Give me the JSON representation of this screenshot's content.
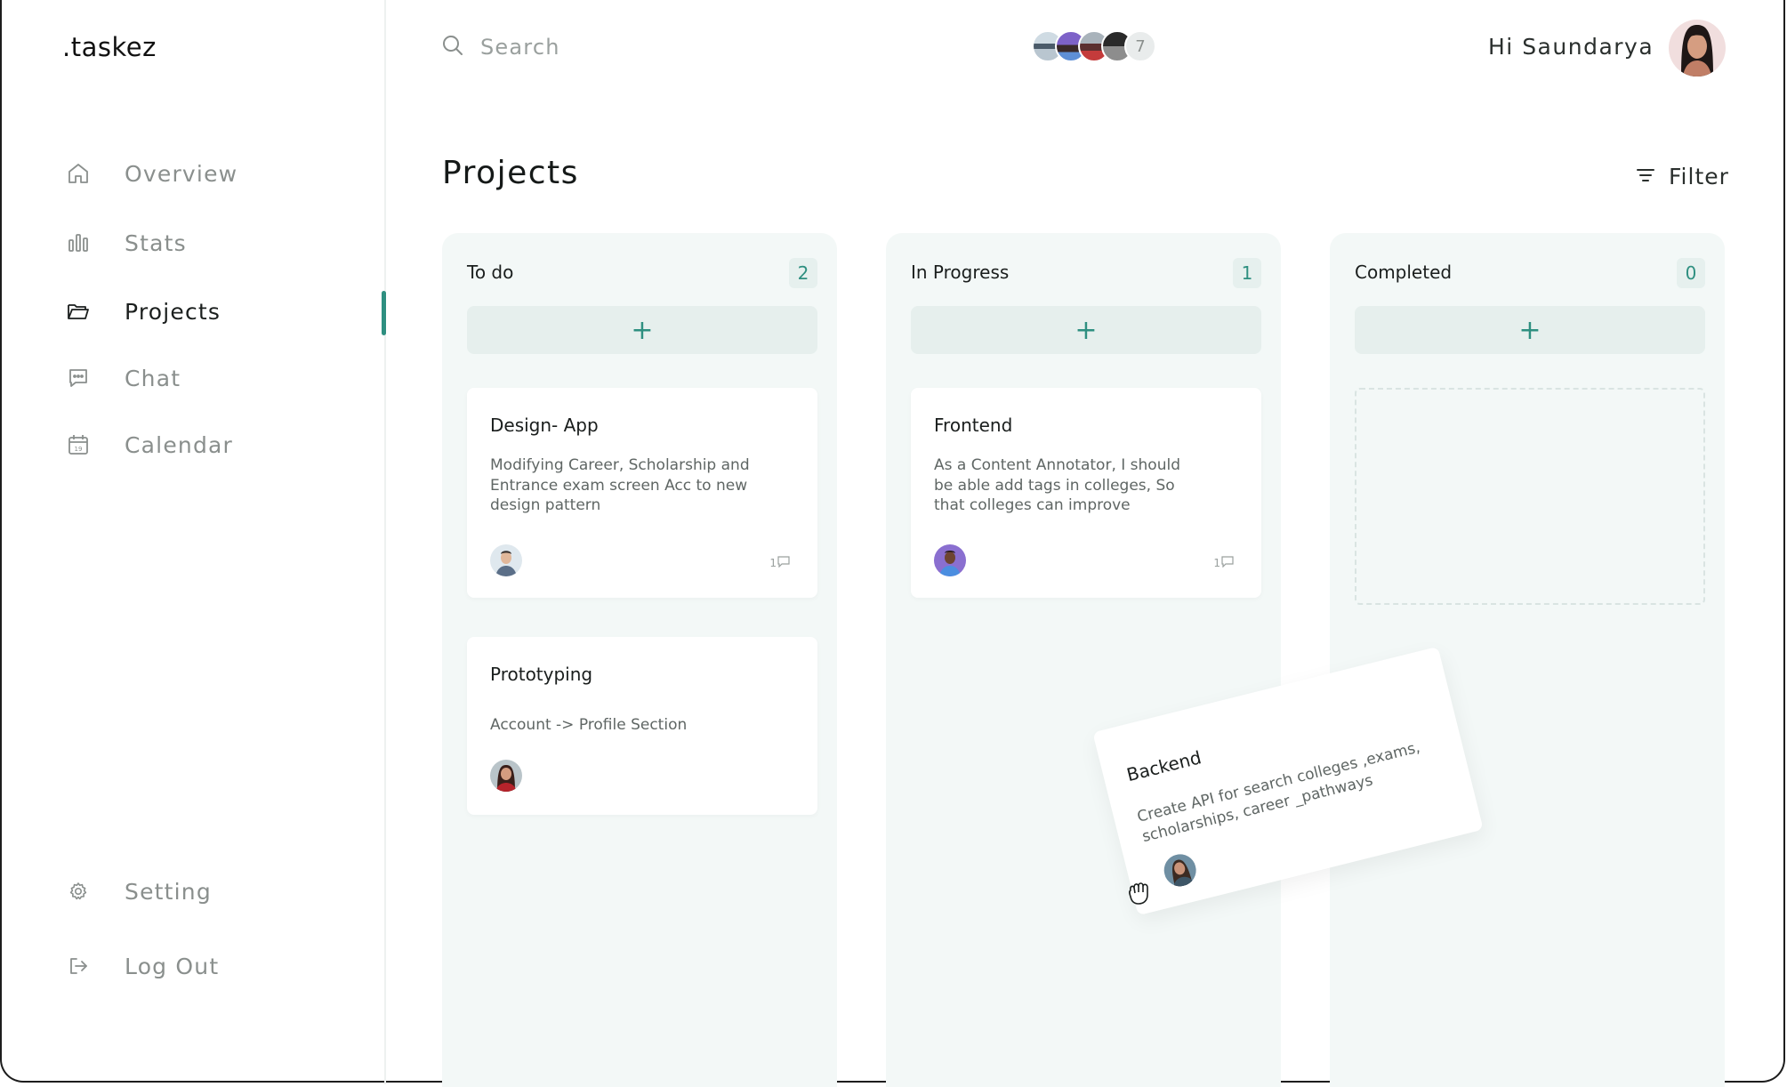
{
  "app": {
    "logo": ".taskez"
  },
  "sidebar": {
    "items": [
      {
        "label": "Overview",
        "icon": "home-icon"
      },
      {
        "label": "Stats",
        "icon": "bar-chart-icon"
      },
      {
        "label": "Projects",
        "icon": "folder-open-icon",
        "active": true
      },
      {
        "label": "Chat",
        "icon": "chat-bubble-icon"
      },
      {
        "label": "Calendar",
        "icon": "calendar-icon",
        "calendar_day": "19"
      }
    ],
    "bottom": [
      {
        "label": "Setting",
        "icon": "gear-icon"
      },
      {
        "label": "Log Out",
        "icon": "logout-icon"
      }
    ]
  },
  "header": {
    "search_placeholder": "Search",
    "team_extra_count": "7",
    "greeting": "Hi Saundarya"
  },
  "page": {
    "title": "Projects",
    "filter_label": "Filter"
  },
  "columns": [
    {
      "title": "To do",
      "count": "2",
      "cards": [
        {
          "title": "Design- App",
          "description": "Modifying Career, Scholarship and Entrance exam screen Acc to new design pattern",
          "comments": "1"
        },
        {
          "title": "Prototyping",
          "description": "Account -> Profile Section"
        }
      ]
    },
    {
      "title": "In Progress",
      "count": "1",
      "cards": [
        {
          "title": "Frontend",
          "description": "As a Content Annotator, I should be able add tags in colleges, So that colleges can improve",
          "comments": "1"
        }
      ]
    },
    {
      "title": "Completed",
      "count": "0",
      "cards": []
    }
  ],
  "dragging_card": {
    "title": "Backend",
    "description": "Create API for search colleges ,exams, scholarships, career _pathways"
  },
  "colors": {
    "accent": "#2e8f80",
    "column_bg": "#f3f8f7",
    "muted_text": "#8a8f8d"
  }
}
